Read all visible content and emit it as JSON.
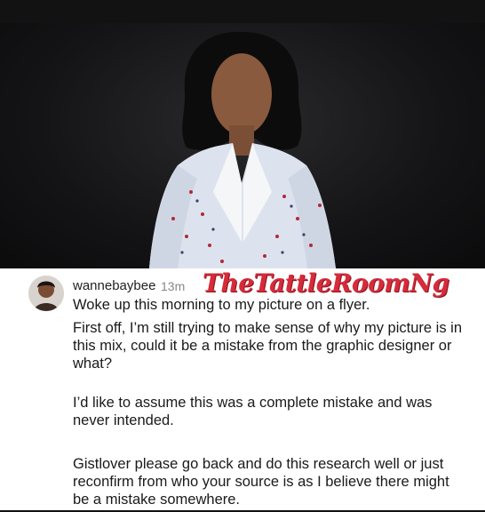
{
  "comment": {
    "username": "wannebaybee",
    "time": "13m",
    "watermark": "TheTattleRoomNg",
    "paragraphs": [
      "Woke up this morning to my picture on a flyer.",
      "First off, I’m still trying to make sense of why my picture is in this mix, could it be a mistake from the graphic designer or what?",
      "I’d like to assume this was a complete mistake and was never intended.",
      "Gistlover please go back and do this research well or just reconfirm from who your source  is as I believe there might be a mistake somewhere."
    ]
  },
  "colors": {
    "watermark": "#d62b3a",
    "photo_background": "#141416",
    "blazer": "#dde3ee"
  }
}
